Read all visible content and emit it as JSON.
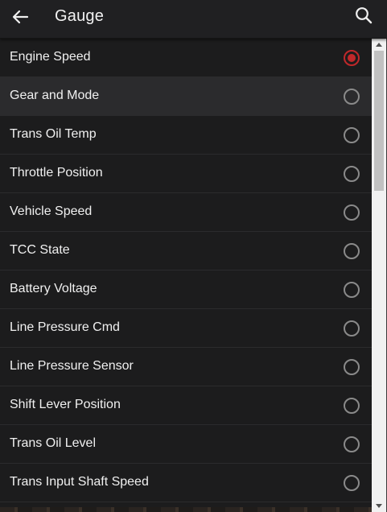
{
  "header": {
    "title": "Gauge",
    "back_icon": "arrow-left-icon",
    "search_icon": "search-icon"
  },
  "colors": {
    "accent": "#c0282a",
    "background": "#1c1c1d",
    "highlight_row": "#2b2b2d",
    "text": "#f0f0f0"
  },
  "list": {
    "items": [
      {
        "label": "Engine Speed",
        "selected": true
      },
      {
        "label": "Gear and Mode",
        "selected": false
      },
      {
        "label": "Trans Oil Temp",
        "selected": false
      },
      {
        "label": "Throttle Position",
        "selected": false
      },
      {
        "label": "Vehicle Speed",
        "selected": false
      },
      {
        "label": "TCC State",
        "selected": false
      },
      {
        "label": "Battery Voltage",
        "selected": false
      },
      {
        "label": "Line Pressure Cmd",
        "selected": false
      },
      {
        "label": "Line Pressure Sensor",
        "selected": false
      },
      {
        "label": "Shift Lever Position",
        "selected": false
      },
      {
        "label": "Trans Oil Level",
        "selected": false
      },
      {
        "label": "Trans Input Shaft Speed",
        "selected": false
      }
    ]
  }
}
